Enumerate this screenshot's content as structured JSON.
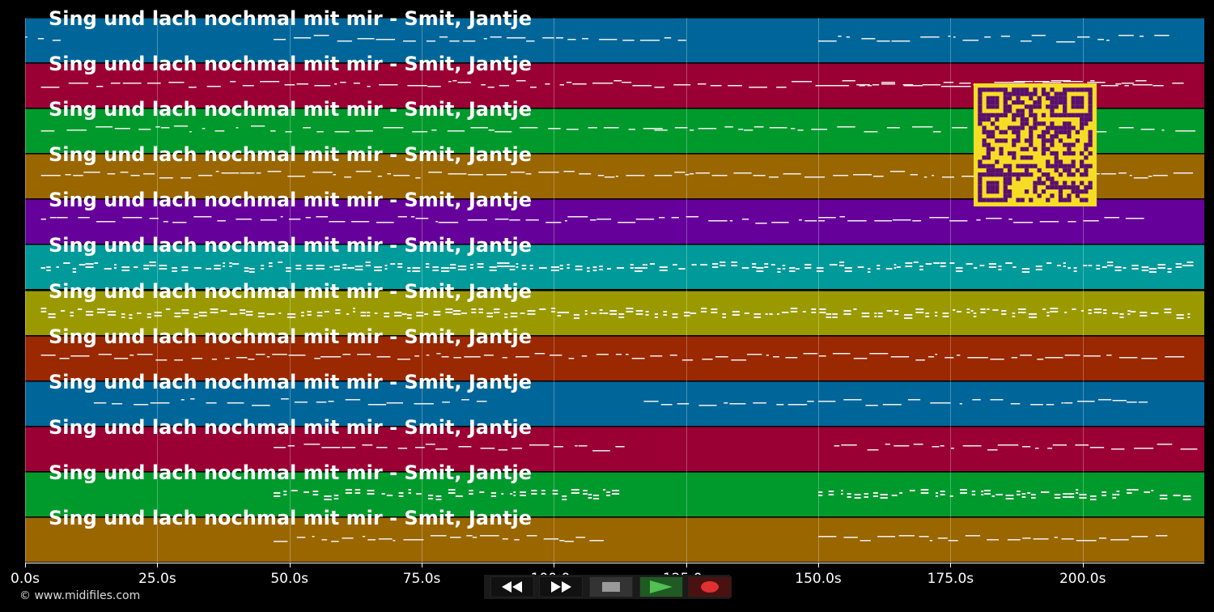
{
  "song_title": "Sing und lach nochmal mit mir - Smit, Jantje",
  "lanes": [
    {
      "title": "Sing und lach nochmal mit mir - Smit, Jantje",
      "color": "#00669a"
    },
    {
      "title": "Sing und lach nochmal mit mir - Smit, Jantje",
      "color": "#9a0034"
    },
    {
      "title": "Sing und lach nochmal mit mir - Smit, Jantje",
      "color": "#009a2c"
    },
    {
      "title": "Sing und lach nochmal mit mir - Smit, Jantje",
      "color": "#9a6600"
    },
    {
      "title": "Sing und lach nochmal mit mir - Smit, Jantje",
      "color": "#66009a"
    },
    {
      "title": "Sing und lach nochmal mit mir - Smit, Jantje",
      "color": "#009a9a"
    },
    {
      "title": "Sing und lach nochmal mit mir - Smit, Jantje",
      "color": "#9a9a00"
    },
    {
      "title": "Sing und lach nochmal mit mir - Smit, Jantje",
      "color": "#9a2800"
    },
    {
      "title": "Sing und lach nochmal mit mir - Smit, Jantje",
      "color": "#00669a"
    },
    {
      "title": "Sing und lach nochmal mit mir - Smit, Jantje",
      "color": "#9a0034"
    },
    {
      "title": "Sing und lach nochmal mit mir - Smit, Jantje",
      "color": "#009a2c"
    },
    {
      "title": "Sing und lach nochmal mit mir - Smit, Jantje",
      "color": "#9a6600"
    }
  ],
  "time_axis": {
    "ticks": [
      "0.0s",
      "25.0s",
      "50.0s",
      "75.0s",
      "100.0s",
      "125.0s",
      "150.0s",
      "175.0s",
      "200.0s"
    ],
    "range_seconds": [
      0,
      223
    ]
  },
  "copyright": "© www.midifiles.com",
  "controls": [
    {
      "name": "rewind-button",
      "icon": "rewind-icon"
    },
    {
      "name": "fast-forward-button",
      "icon": "fast-forward-icon"
    },
    {
      "name": "stop-button",
      "icon": "stop-icon"
    },
    {
      "name": "play-button",
      "icon": "play-icon",
      "accent": "#3c9a3c"
    },
    {
      "name": "record-button",
      "icon": "record-icon",
      "accent": "#e03030"
    }
  ],
  "qr_code": {
    "icon": "qr-code-icon",
    "bg": "#f6dd25",
    "fg": "#5a0f6e"
  }
}
